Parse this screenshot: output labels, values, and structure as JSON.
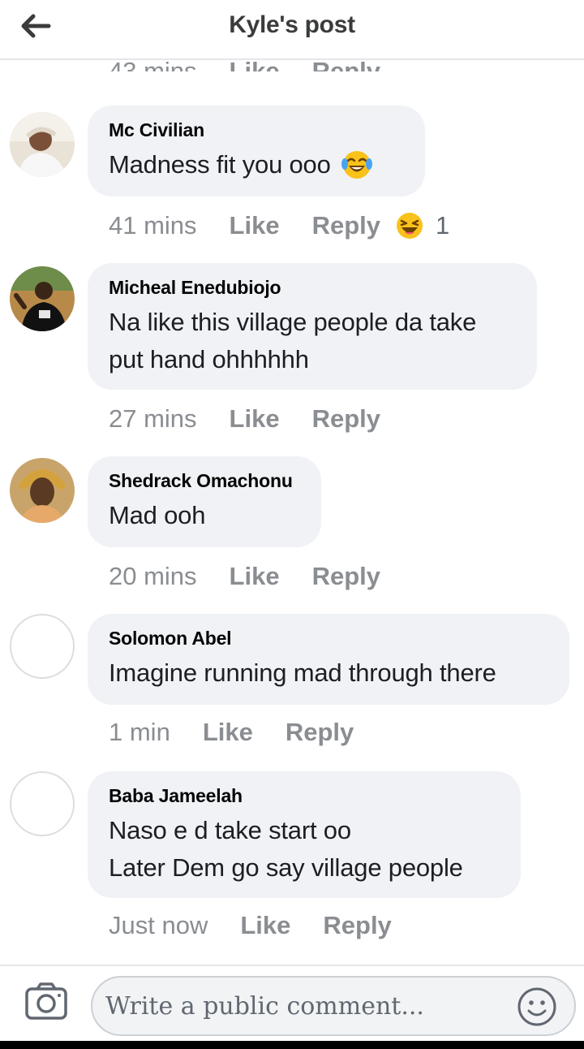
{
  "header": {
    "title": "Kyle's post",
    "back_icon": "arrow-left-icon"
  },
  "partial_row": {
    "time": "43 mins",
    "like": "Like",
    "reply": "Reply"
  },
  "comments": [
    {
      "author": "Mc Civilian",
      "text": "Madness fit you ooo",
      "time": "41 mins",
      "like": "Like",
      "reply": "Reply",
      "reaction_icon": "haha-reaction-icon",
      "reaction_count": "1"
    },
    {
      "author": "Micheal Enedubiojo",
      "text": "Na like this village people da take\nput hand ohhhhhh",
      "time": "27 mins",
      "like": "Like",
      "reply": "Reply"
    },
    {
      "author": "Shedrack Omachonu",
      "text": "Mad ooh",
      "time": "20 mins",
      "like": "Like",
      "reply": "Reply"
    },
    {
      "author": "Solomon Abel",
      "text": "Imagine running mad through there",
      "time": "1 min",
      "like": "Like",
      "reply": "Reply"
    },
    {
      "author": "Baba Jameelah",
      "text": "Naso e d take start oo\nLater Dem go say village people",
      "time": "Just now",
      "like": "Like",
      "reply": "Reply"
    }
  ],
  "composer": {
    "placeholder": "Write a public comment...",
    "camera_icon": "camera-icon",
    "emoji_icon": "smiley-icon"
  },
  "colors": {
    "bubble": "#f0f2f5",
    "meta_text": "#8a8d91",
    "title": "#3a3b3c"
  }
}
